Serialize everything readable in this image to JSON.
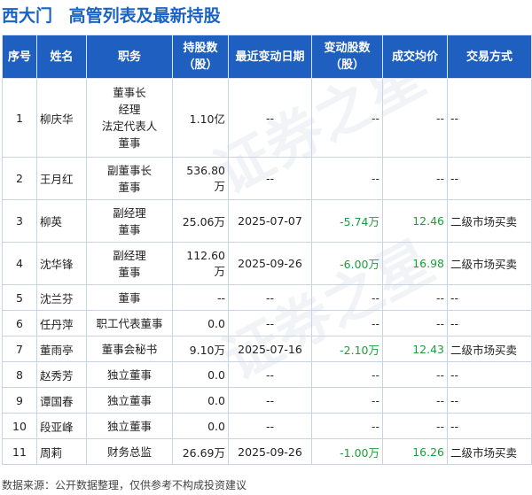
{
  "title": {
    "company": "西大门",
    "subtitle": "高管列表及最新持股"
  },
  "table": {
    "headers": {
      "idx": "序号",
      "name": "姓名",
      "position": "职务",
      "holding_l1": "持股数",
      "holding_l2": "（股）",
      "date": "最近变动日期",
      "change_l1": "变动股数",
      "change_l2": "（股）",
      "price": "成交均价",
      "method": "交易方式"
    },
    "rows": [
      {
        "idx": "1",
        "name": "柳庆华",
        "positions": [
          "董事长",
          "经理",
          "法定代表人",
          "董事"
        ],
        "holding": "1.10亿",
        "date": "--",
        "change": "--",
        "price": "--",
        "method": "--"
      },
      {
        "idx": "2",
        "name": "王月红",
        "positions": [
          "副董事长",
          "董事"
        ],
        "holding": "536.80万",
        "date": "--",
        "change": "--",
        "price": "--",
        "method": "--"
      },
      {
        "idx": "3",
        "name": "柳英",
        "positions": [
          "副经理",
          "董事"
        ],
        "holding": "25.06万",
        "date": "2025-07-07",
        "change": "-5.74万",
        "price": "12.46",
        "method": "二级市场买卖"
      },
      {
        "idx": "4",
        "name": "沈华锋",
        "positions": [
          "副经理",
          "董事"
        ],
        "holding": "112.60万",
        "date": "2025-09-26",
        "change": "-6.00万",
        "price": "16.98",
        "method": "二级市场买卖"
      },
      {
        "idx": "5",
        "name": "沈兰芬",
        "positions": [
          "董事"
        ],
        "holding": "--",
        "date": "--",
        "change": "--",
        "price": "--",
        "method": "--"
      },
      {
        "idx": "6",
        "name": "任丹萍",
        "positions": [
          "职工代表董事"
        ],
        "holding": "0.0",
        "date": "--",
        "change": "--",
        "price": "--",
        "method": "--"
      },
      {
        "idx": "7",
        "name": "董雨亭",
        "positions": [
          "董事会秘书"
        ],
        "holding": "9.10万",
        "date": "2025-07-16",
        "change": "-2.10万",
        "price": "12.43",
        "method": "二级市场买卖"
      },
      {
        "idx": "8",
        "name": "赵秀芳",
        "positions": [
          "独立董事"
        ],
        "holding": "0.0",
        "date": "--",
        "change": "--",
        "price": "--",
        "method": "--"
      },
      {
        "idx": "9",
        "name": "谭国春",
        "positions": [
          "独立董事"
        ],
        "holding": "0.0",
        "date": "--",
        "change": "--",
        "price": "--",
        "method": "--"
      },
      {
        "idx": "10",
        "name": "段亚峰",
        "positions": [
          "独立董事"
        ],
        "holding": "0.0",
        "date": "--",
        "change": "--",
        "price": "--",
        "method": "--"
      },
      {
        "idx": "11",
        "name": "周莉",
        "positions": [
          "财务总监"
        ],
        "holding": "26.69万",
        "date": "2025-09-26",
        "change": "-1.00万",
        "price": "16.26",
        "method": "二级市场买卖"
      }
    ]
  },
  "footer": "数据来源：公开数据整理，仅供参考不构成投资建议",
  "watermark": "证券之星",
  "colors": {
    "accent": "#1e5fbf",
    "title": "#1a63c6",
    "positive": "#1e9e3a"
  }
}
